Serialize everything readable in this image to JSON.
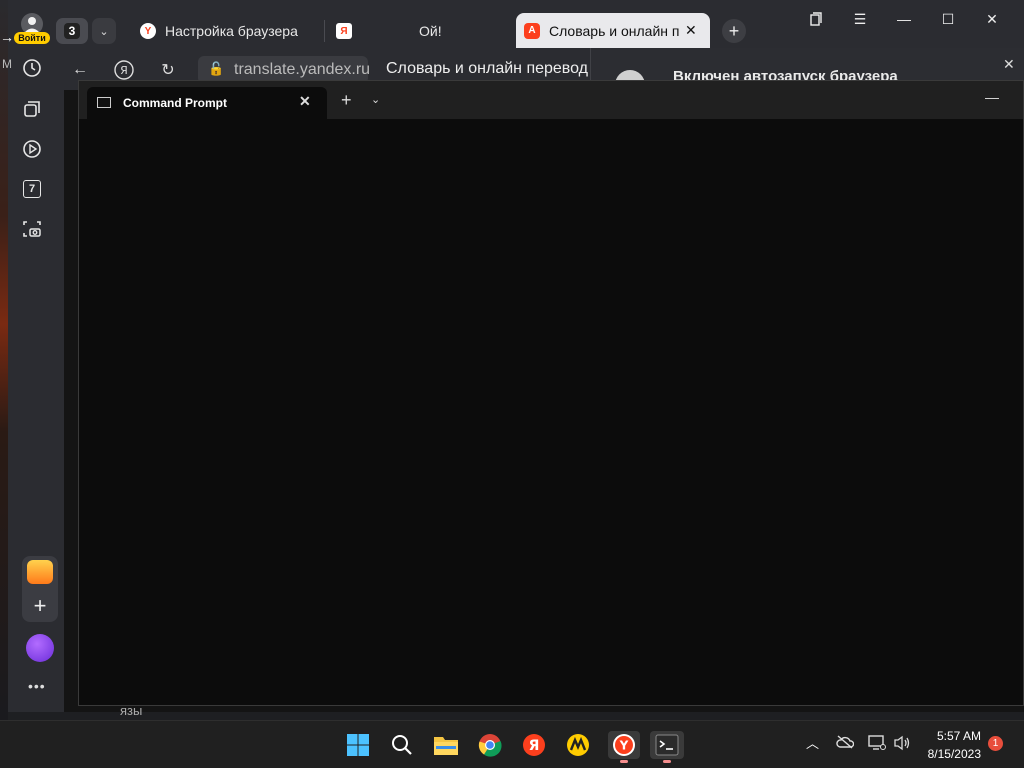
{
  "browser": {
    "login_badge": "Войти",
    "tab_count": "3",
    "tabs": [
      {
        "label": "Настройка браузера",
        "favicon": "yandex-y-icon"
      },
      {
        "label": "Ой!",
        "favicon": "yandex-ya-icon"
      },
      {
        "label": "Словарь и онлайн пер",
        "favicon": "yandex-translate-icon"
      }
    ],
    "address": {
      "url": "translate.yandex.ru",
      "page_title": "Словарь и онлайн перевод"
    },
    "notification": {
      "text": "Включен автозапуск браузера"
    },
    "behind_text": "язы",
    "sidebar_left_letter": "M",
    "sidebar_items": [
      "history-icon",
      "collections-icon",
      "video-icon",
      "calendar-icon",
      "screenshot-icon"
    ],
    "calendar_day": "7"
  },
  "terminal": {
    "tab_label": "Command Prompt"
  },
  "taskbar": {
    "apps": [
      "windows-start-icon",
      "search-icon",
      "file-explorer-icon",
      "chrome-icon",
      "yandex-icon",
      "yandex-market-icon",
      "yandex-browser-icon",
      "terminal-icon"
    ],
    "time": "5:57 AM",
    "date": "8/15/2023",
    "notification_count": "1"
  },
  "colors": {
    "accent_yellow": "#ffcc00",
    "yandex_red": "#fc3f1d",
    "alice_purple": "#8a3ffc"
  }
}
